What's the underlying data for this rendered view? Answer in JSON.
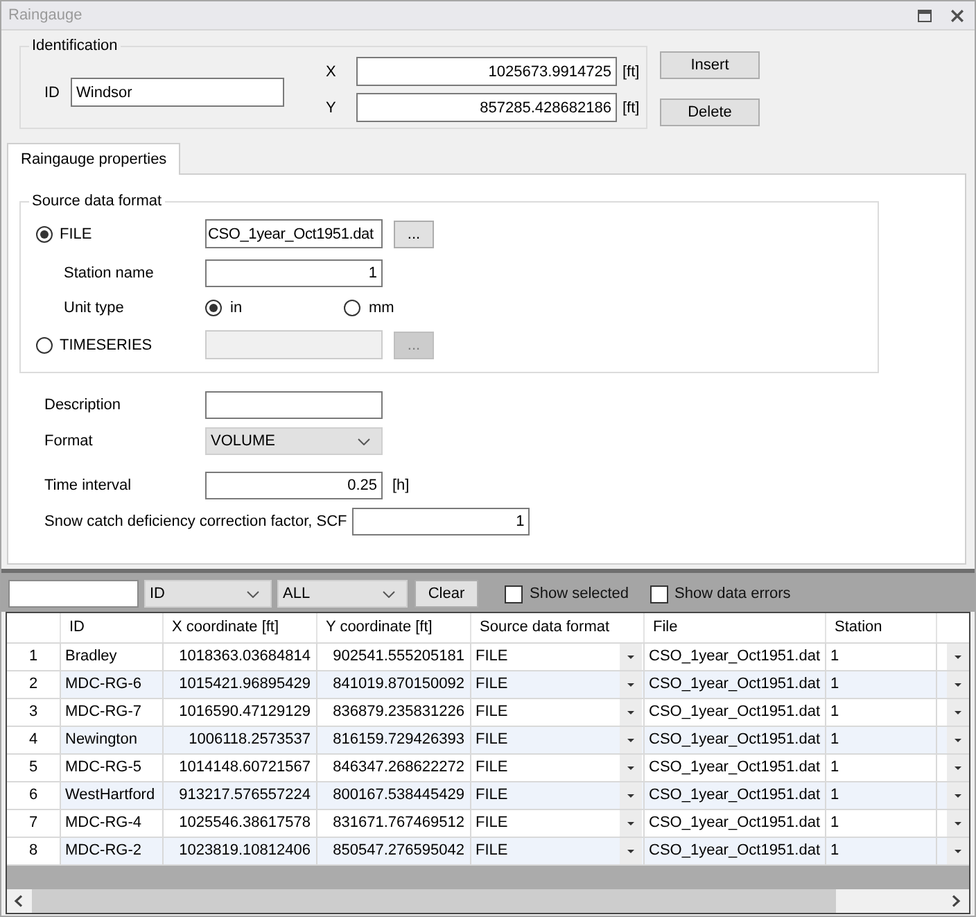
{
  "window": {
    "title": "Raingauge"
  },
  "identification": {
    "title": "Identification",
    "id": {
      "label": "ID",
      "value": "Windsor"
    },
    "coords": [
      {
        "label": "X",
        "value": "1025673.9914725",
        "unit": "[ft]"
      },
      {
        "label": "Y",
        "value": "857285.428682186",
        "unit": "[ft]"
      }
    ]
  },
  "buttons": [
    {
      "label": "Insert"
    },
    {
      "label": "Delete"
    }
  ],
  "tabs": [
    {
      "label": "Raingauge properties",
      "selected": true
    }
  ],
  "source": {
    "title": "Source data format",
    "file": {
      "label": "FILE",
      "selected": true,
      "disabled": false,
      "value": "CSO_1year_Oct1951.dat",
      "browse": "..."
    },
    "station_name": {
      "label": "Station name",
      "value": "1"
    },
    "unit_type": {
      "label": "Unit type",
      "options": [
        {
          "label": "in",
          "selected": true
        },
        {
          "label": "mm",
          "selected": false
        }
      ]
    },
    "timeseries": {
      "label": "TIMESERIES",
      "selected": false,
      "disabled": true,
      "browse": "..."
    }
  },
  "properties": [
    {
      "kind": "text",
      "label": "Description"
    },
    {
      "kind": "select",
      "label": "Format",
      "value": "VOLUME"
    },
    {
      "kind": "number",
      "label": "Time interval",
      "value": "0.25",
      "unit": "[h]"
    },
    {
      "kind": "number",
      "label": "Snow catch deficiency correction factor, SCF",
      "value": "1"
    }
  ],
  "filter": {
    "column": "ID",
    "scope": "ALL",
    "clear": "Clear",
    "checkboxes": [
      {
        "label": "Show selected",
        "checked": false
      },
      {
        "label": "Show data errors",
        "checked": false
      }
    ]
  },
  "table": {
    "columns": [
      {
        "label": "ID",
        "kind": "text"
      },
      {
        "label": "X coordinate [ft]",
        "kind": "number"
      },
      {
        "label": "Y coordinate [ft]",
        "kind": "number"
      },
      {
        "label": "Source data format",
        "kind": "dropdown"
      },
      {
        "label": "File",
        "kind": "text"
      },
      {
        "label": "Station",
        "kind": "text"
      }
    ],
    "rows": [
      {
        "number": "1",
        "cells": [
          "Bradley",
          "1018363.03684814",
          "902541.555205181",
          "FILE",
          "CSO_1year_Oct1951.dat",
          "1"
        ]
      },
      {
        "number": "2",
        "cells": [
          "MDC-RG-6",
          "1015421.96895429",
          "841019.870150092",
          "FILE",
          "CSO_1year_Oct1951.dat",
          "1"
        ]
      },
      {
        "number": "3",
        "cells": [
          "MDC-RG-7",
          "1016590.47129129",
          "836879.235831226",
          "FILE",
          "CSO_1year_Oct1951.dat",
          "1"
        ]
      },
      {
        "number": "4",
        "cells": [
          "Newington",
          "1006118.2573537",
          "816159.729426393",
          "FILE",
          "CSO_1year_Oct1951.dat",
          "1"
        ]
      },
      {
        "number": "5",
        "cells": [
          "MDC-RG-5",
          "1014148.60721567",
          "846347.268622272",
          "FILE",
          "CSO_1year_Oct1951.dat",
          "1"
        ]
      },
      {
        "number": "6",
        "cells": [
          "WestHartford",
          "913217.576557224",
          "800167.538445429",
          "FILE",
          "CSO_1year_Oct1951.dat",
          "1"
        ]
      },
      {
        "number": "7",
        "cells": [
          "MDC-RG-4",
          "1025546.38617578",
          "831671.767469512",
          "FILE",
          "CSO_1year_Oct1951.dat",
          "1"
        ]
      },
      {
        "number": "8",
        "cells": [
          "MDC-RG-2",
          "1023819.10812406",
          "850547.276595042",
          "FILE",
          "CSO_1year_Oct1951.dat",
          "1"
        ]
      }
    ]
  }
}
